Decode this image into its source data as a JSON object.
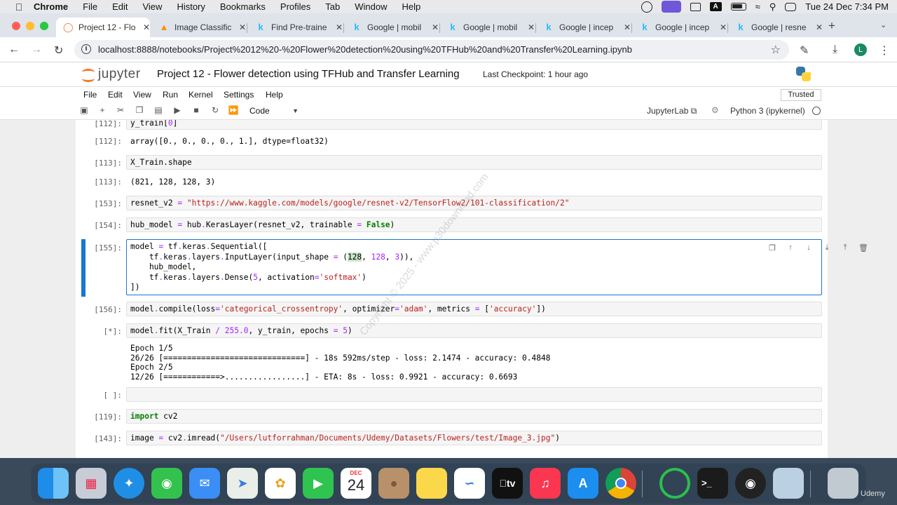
{
  "menubar": {
    "app": "Chrome",
    "items": [
      "File",
      "Edit",
      "View",
      "History",
      "Bookmarks",
      "Profiles",
      "Tab",
      "Window",
      "Help"
    ],
    "clock": "Tue 24 Dec  7:34 PM",
    "icons": [
      "creative-cloud-icon",
      "control-center-app-icon",
      "window-icon",
      "a-icon",
      "battery-icon",
      "wifi-icon",
      "search-icon",
      "control-center-icon"
    ]
  },
  "tabs": [
    {
      "title": "Project 12 - Flo",
      "favicon": "jupyter-icon",
      "active": true
    },
    {
      "title": "Image Classific",
      "favicon": "tensorflow-icon",
      "active": false
    },
    {
      "title": "Find Pre-traine",
      "favicon": "kaggle-icon",
      "active": false
    },
    {
      "title": "Google | mobil",
      "favicon": "kaggle-icon",
      "active": false
    },
    {
      "title": "Google | mobil",
      "favicon": "kaggle-icon",
      "active": false
    },
    {
      "title": "Google | incep",
      "favicon": "kaggle-icon",
      "active": false
    },
    {
      "title": "Google | incep",
      "favicon": "kaggle-icon",
      "active": false
    },
    {
      "title": "Google | resne",
      "favicon": "kaggle-icon",
      "active": false
    }
  ],
  "address": {
    "url": "localhost:8888/notebooks/Project%2012%20-%20Flower%20detection%20using%20TFHub%20and%20Transfer%20Learning.ipynb",
    "avatar": "L"
  },
  "jupyter": {
    "logo_text": "jupyter",
    "title": "Project 12 - Flower detection using TFHub and Transfer Learning",
    "checkpoint": "Last Checkpoint: 1 hour ago",
    "menu": [
      "File",
      "Edit",
      "View",
      "Run",
      "Kernel",
      "Settings",
      "Help"
    ],
    "trusted": "Trusted",
    "cell_type": "Code",
    "jupyterlab_link": "JupyterLab",
    "kernel": "Python 3 (ipykernel)"
  },
  "cells": [
    {
      "prompt": "[112]:",
      "kind": "in",
      "text": "y_train[0]"
    },
    {
      "prompt": "[112]:",
      "kind": "out",
      "text": "array([0., 0., 0., 0., 1.], dtype=float32)"
    },
    {
      "prompt": "[113]:",
      "kind": "in",
      "text": "X_Train.shape"
    },
    {
      "prompt": "[113]:",
      "kind": "out",
      "text": "(821, 128, 128, 3)"
    },
    {
      "prompt": "[153]:",
      "kind": "in",
      "text": "resnet_v2 = \"https://www.kaggle.com/models/google/resnet-v2/TensorFlow2/101-classification/2\""
    },
    {
      "prompt": "[154]:",
      "kind": "in",
      "text": "hub_model = hub.KerasLayer(resnet_v2, trainable = False)"
    },
    {
      "prompt": "[155]:",
      "kind": "in",
      "text": "model = tf.keras.Sequential([\n    tf.keras.layers.InputLayer(input_shape = (128, 128, 3)),\n    hub_model,\n    tf.keras.layers.Dense(5, activation='softmax')\n])"
    },
    {
      "prompt": "[156]:",
      "kind": "in",
      "text": "model.compile(loss='categorical_crossentropy', optimizer='adam', metrics = ['accuracy'])"
    },
    {
      "prompt": "[*]:",
      "kind": "in",
      "text": "model.fit(X_Train / 255.0, y_train, epochs = 5)"
    },
    {
      "prompt": "",
      "kind": "out",
      "text": "Epoch 1/5\n26/26 [==============================] - 18s 592ms/step - loss: 2.1474 - accuracy: 0.4848\nEpoch 2/5\n12/26 [============>.................] - ETA: 8s - loss: 0.9921 - accuracy: 0.6693"
    },
    {
      "prompt": "[ ]:",
      "kind": "in",
      "text": ""
    },
    {
      "prompt": "[119]:",
      "kind": "in",
      "text": "import cv2"
    },
    {
      "prompt": "[143]:",
      "kind": "in",
      "text": "image = cv2.imread(\"/Users/lutforrahman/Documents/Udemy/Datasets/Flowers/test/Image_3.jpg\")"
    }
  ],
  "watermark": "Copyright © 2025 - www.p30download.com",
  "dock": {
    "calendar_month": "DEC",
    "calendar_day": "24",
    "appletv_label": "tv"
  },
  "udemy_tag": "Udemy",
  "colors": {
    "accent": "#1976d2",
    "jupyter_orange": "#f37726",
    "string": "#ba2121",
    "keyword": "#008000"
  }
}
